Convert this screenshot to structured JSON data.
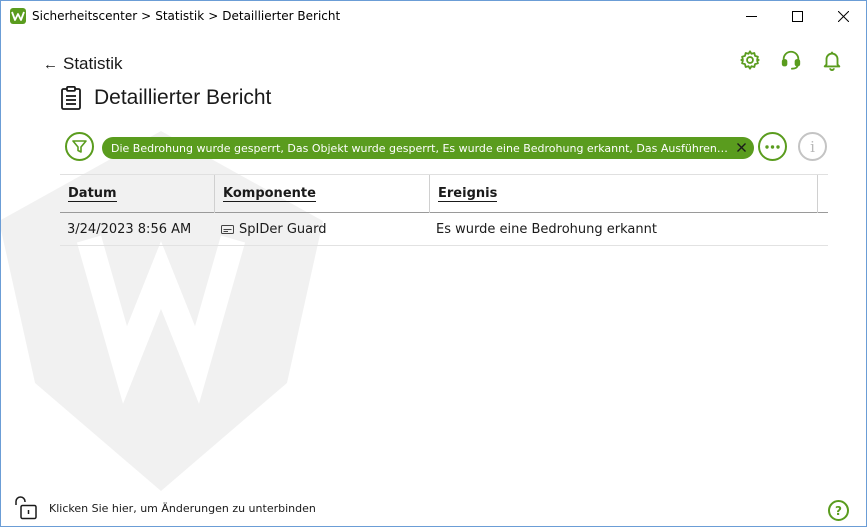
{
  "window": {
    "breadcrumb": [
      "Sicherheitscenter",
      "Statistik",
      "Detaillierter Bericht"
    ],
    "breadcrumb_separator": ">",
    "controls": [
      "minimize-icon",
      "maximize-icon",
      "close-icon"
    ]
  },
  "header": {
    "back_label": "Statistik",
    "title": "Detaillierter Bericht",
    "icons": [
      "gear-icon",
      "headset-icon",
      "bell-icon"
    ]
  },
  "filter": {
    "chip_text": "Die Bedrohung wurde gesperrt, Das Objekt wurde gesperrt, Es wurde eine Bedrohung erkannt, Das Ausführen von ni...",
    "more_icon": "more-icon",
    "info_icon": "info-icon",
    "info_glyph": "i"
  },
  "table": {
    "columns": [
      "Datum",
      "Komponente",
      "Ereignis"
    ],
    "rows": [
      {
        "date": "3/24/2023 8:56 AM",
        "component": "SpIDer Guard",
        "event": "Es wurde eine Bedrohung erkannt"
      }
    ]
  },
  "footer": {
    "lock_text": "Klicken Sie hier, um Änderungen zu unterbinden",
    "help_glyph": "?"
  },
  "colors": {
    "accent": "#5a9c1e",
    "border": "#6b9dd6",
    "disabled": "#c4c4c4"
  }
}
